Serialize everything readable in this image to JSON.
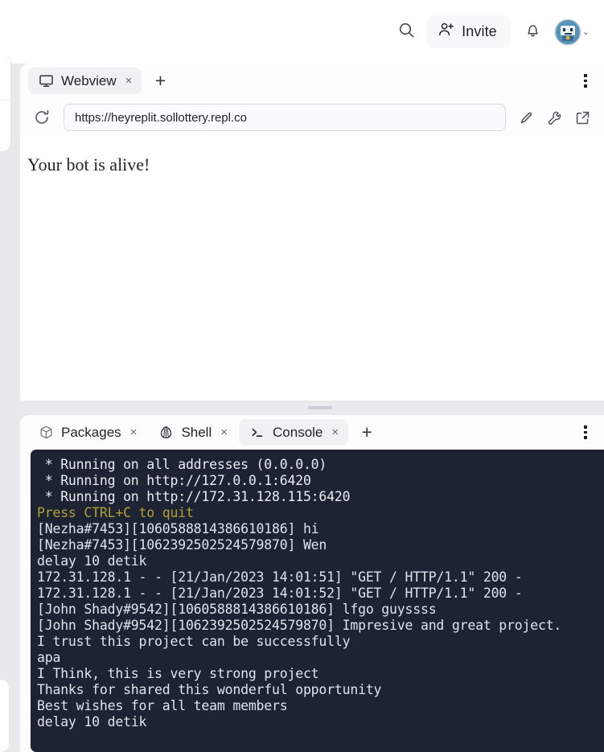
{
  "topbar": {
    "search_icon": "search-icon",
    "invite_label": "Invite",
    "invite_icon": "person-plus-icon",
    "bell_icon": "bell-icon",
    "avatar_icon": "user-avatar-bot",
    "chevron": "⌄"
  },
  "webview": {
    "tabs": [
      {
        "label": "Webview",
        "icon": "monitor-icon",
        "active": true,
        "close": "×"
      }
    ],
    "new_tab": "+",
    "url": "https://heyreplit.sollottery.repl.co",
    "reload_icon": "reload-icon",
    "actions": [
      {
        "icon": "pencil-icon",
        "name": "edit-url-button"
      },
      {
        "icon": "wrench-icon",
        "name": "devtools-button"
      },
      {
        "icon": "external-link-icon",
        "name": "open-new-tab-button"
      }
    ],
    "page_text": "Your bot is alive!",
    "kebab": "more-options-icon"
  },
  "console": {
    "tabs": [
      {
        "label": "Packages",
        "icon": "package-box-icon",
        "active": false,
        "close": "×"
      },
      {
        "label": "Shell",
        "icon": "shell-icon",
        "active": false,
        "close": "×"
      },
      {
        "label": "Console",
        "icon": ">_",
        "active": true,
        "close": "×"
      }
    ],
    "new_tab": "+",
    "kebab": "more-options-icon",
    "background": "#1e2333",
    "lines": [
      {
        "text": " * Running on all addresses (0.0.0.0)",
        "color": "white"
      },
      {
        "text": " * Running on http://127.0.0.1:6420",
        "color": "white"
      },
      {
        "text": " * Running on http://172.31.128.115:6420",
        "color": "white"
      },
      {
        "text": "Press CTRL+C to quit",
        "color": "yellow"
      },
      {
        "text": "[Nezha#7453][1060588814386610186] hi",
        "color": "log"
      },
      {
        "text": "[Nezha#7453][1062392502524579870] Wen",
        "color": "log"
      },
      {
        "text": "delay 10 detik",
        "color": "log"
      },
      {
        "text": "172.31.128.1 - - [21/Jan/2023 14:01:51] \"GET / HTTP/1.1\" 200 -",
        "color": "log"
      },
      {
        "text": "172.31.128.1 - - [21/Jan/2023 14:01:52] \"GET / HTTP/1.1\" 200 -",
        "color": "log"
      },
      {
        "text": "[John Shady#9542][1060588814386610186] lfgo guyssss",
        "color": "log"
      },
      {
        "text": "[John Shady#9542][1062392502524579870] Impresive and great project.",
        "color": "log"
      },
      {
        "text": "I trust this project can be successfully",
        "color": "log"
      },
      {
        "text": "apa",
        "color": "log"
      },
      {
        "text": "I Think, this is very strong project",
        "color": "log"
      },
      {
        "text": "Thanks for shared this wonderful opportunity",
        "color": "log"
      },
      {
        "text": "Best wishes for all team members",
        "color": "log"
      },
      {
        "text": "delay 10 detik",
        "color": "log"
      }
    ]
  }
}
